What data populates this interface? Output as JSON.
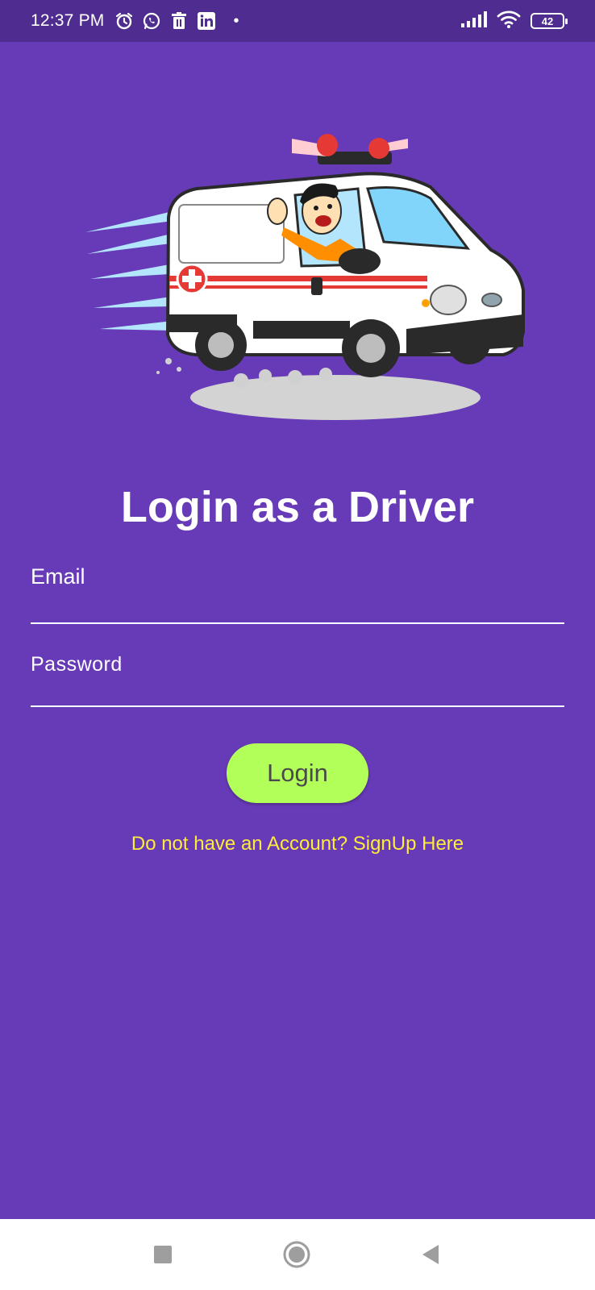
{
  "status_bar": {
    "time": "12:37 PM",
    "notification_icons": [
      "alarm-icon",
      "whatsapp-icon",
      "trash-icon",
      "linkedin-icon"
    ],
    "battery_level": "42",
    "signal_icon": "signal-icon",
    "wifi_icon": "wifi-icon"
  },
  "hero": {
    "illustration": "ambulance-driver-illustration"
  },
  "login": {
    "title": "Login as a Driver",
    "email_label": "Email",
    "password_label": "Password",
    "button_label": "Login",
    "signup_link": "Do not have an Account? SignUp Here"
  },
  "nav_bar": {
    "recents_icon": "square-icon",
    "home_icon": "circle-icon",
    "back_icon": "triangle-back-icon"
  },
  "colors": {
    "background": "#673AB7",
    "status_bar": "#4F2C8F",
    "button": "#B2FF59",
    "link": "#FFEB3B",
    "text": "#FFFFFF"
  }
}
